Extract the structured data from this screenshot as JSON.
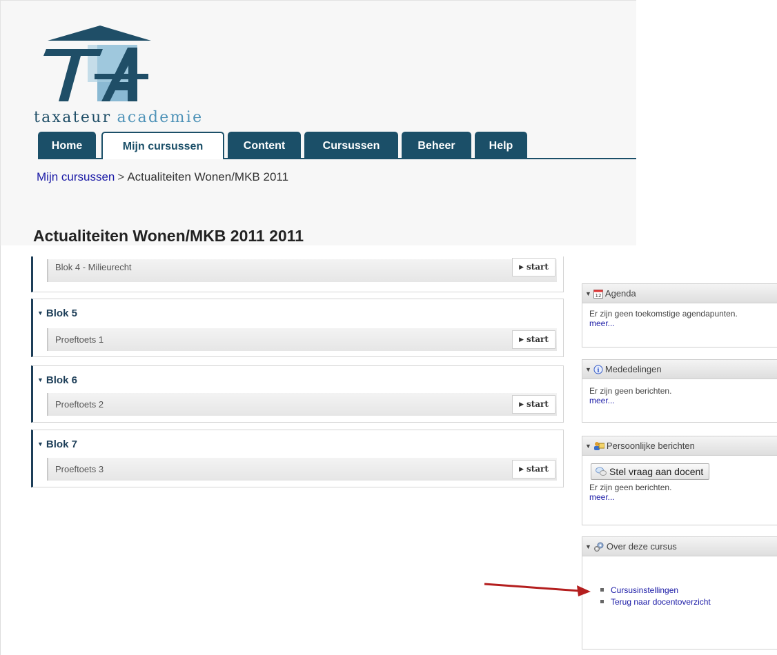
{
  "logo": {
    "word1": "taxateur",
    "word2": "academie"
  },
  "nav": {
    "tabs": [
      {
        "label": "Home"
      },
      {
        "label": "Mijn cursussen"
      },
      {
        "label": "Content"
      },
      {
        "label": "Cursussen"
      },
      {
        "label": "Beheer"
      },
      {
        "label": "Help"
      }
    ],
    "active_tab": "Mijn cursussen"
  },
  "breadcrumb": {
    "link": "Mijn cursussen",
    "separator": ">",
    "current": "Actualiteiten Wonen/MKB 2011"
  },
  "page_title": "Actualiteiten Wonen/MKB 2011 2011",
  "blocks": [
    {
      "title": "",
      "item": "Blok 4 - Milieurecht",
      "start": "start"
    },
    {
      "title": "Blok 5",
      "item": "Proeftoets 1",
      "start": "start"
    },
    {
      "title": "Blok 6",
      "item": "Proeftoets 2",
      "start": "start"
    },
    {
      "title": "Blok 7",
      "item": "Proeftoets 3",
      "start": "start"
    }
  ],
  "widgets": {
    "agenda": {
      "title": "Agenda",
      "text": "Er zijn geen toekomstige agendapunten.",
      "more": "meer..."
    },
    "mededelingen": {
      "title": "Mededelingen",
      "text": "Er zijn geen berichten.",
      "more": "meer..."
    },
    "berichten": {
      "title": "Persoonlijke berichten",
      "button": "Stel vraag aan docent",
      "text": "Er zijn geen berichten.",
      "more": "meer..."
    },
    "over": {
      "title": "Over deze cursus",
      "links": [
        "Cursusinstellingen",
        "Terug naar docentoverzicht"
      ]
    }
  },
  "colors": {
    "brand_dark": "#1b4f68",
    "brand_light": "#4f93b8",
    "link": "#1a1aa6",
    "annotation_arrow": "#b41e1e"
  }
}
